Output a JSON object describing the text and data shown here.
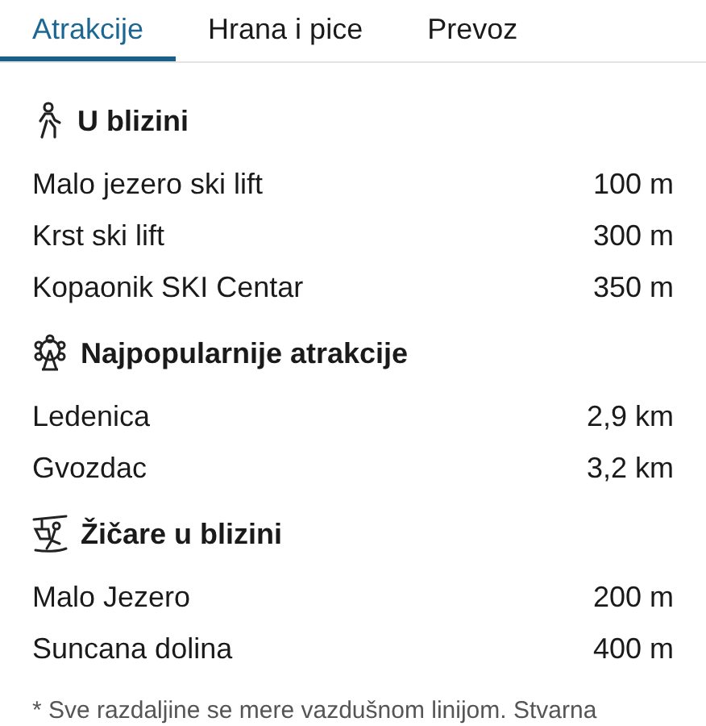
{
  "tabs": [
    {
      "label": "Atrakcije",
      "selected": true
    },
    {
      "label": "Hrana i pice",
      "selected": false
    },
    {
      "label": "Prevoz",
      "selected": false
    }
  ],
  "sections": [
    {
      "kind": "walk",
      "title": "U blizini",
      "items": [
        {
          "name": "Malo jezero ski lift",
          "distance": "100 m"
        },
        {
          "name": "Krst ski lift",
          "distance": "300 m"
        },
        {
          "name": "Kopaonik SKI Centar",
          "distance": "350 m"
        }
      ]
    },
    {
      "kind": "wheel",
      "title": "Najpopularnije atrakcije",
      "items": [
        {
          "name": "Ledenica",
          "distance": "2,9 km"
        },
        {
          "name": "Gvozdac",
          "distance": "3,2 km"
        }
      ]
    },
    {
      "kind": "lift",
      "title": "Žičare u blizini",
      "items": [
        {
          "name": "Malo Jezero",
          "distance": "200 m"
        },
        {
          "name": "Suncana dolina",
          "distance": "400 m"
        }
      ]
    }
  ],
  "footnote": "* Sve razdaljine se mere vazdušnom linijom. Stvarna"
}
